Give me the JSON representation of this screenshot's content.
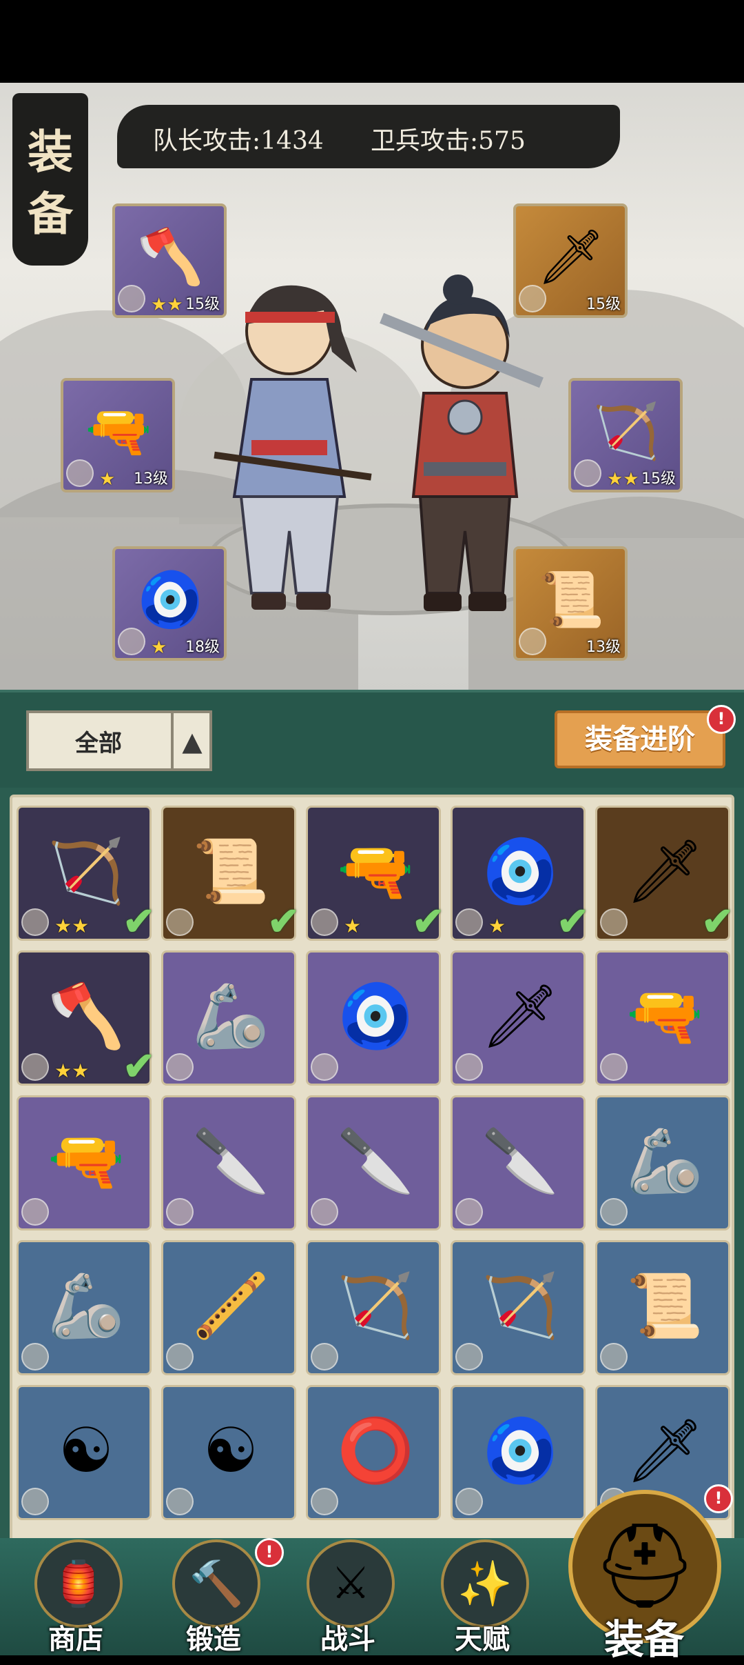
{
  "header": {
    "title": "装备",
    "captain_attack": "队长攻击:1434",
    "guard_attack": "卫兵攻击:575"
  },
  "equipped": {
    "left": [
      {
        "name": "axe",
        "icon": "🪓",
        "rarity": "purple",
        "stars": "★★",
        "level": "15级"
      },
      {
        "name": "cannon",
        "icon": "🔫",
        "rarity": "purple",
        "stars": "★",
        "level": "13级"
      },
      {
        "name": "jade-pendant",
        "icon": "🧿",
        "rarity": "purple",
        "stars": "★",
        "level": "18级"
      }
    ],
    "right": [
      {
        "name": "dagger",
        "icon": "🗡",
        "rarity": "gold",
        "stars": "",
        "level": "15级"
      },
      {
        "name": "bow",
        "icon": "🏹",
        "rarity": "purple",
        "stars": "★★",
        "level": "15级"
      },
      {
        "name": "talisman",
        "icon": "📜",
        "rarity": "gold",
        "stars": "",
        "level": "13级"
      }
    ]
  },
  "filter": {
    "selected": "全部",
    "arrow": "▲",
    "advance_button": "装备进阶",
    "advance_badge": "!"
  },
  "inventory": [
    {
      "icon": "🏹",
      "rarity": "dark",
      "stars": "★★",
      "equipped": "✔"
    },
    {
      "icon": "📜",
      "rarity": "darkgold",
      "stars": "",
      "equipped": "✔"
    },
    {
      "icon": "🔫",
      "rarity": "dark",
      "stars": "★",
      "equipped": "✔"
    },
    {
      "icon": "🧿",
      "rarity": "dark",
      "stars": "★",
      "equipped": "✔"
    },
    {
      "icon": "🗡",
      "rarity": "darkgold",
      "stars": "",
      "equipped": "✔"
    },
    {
      "icon": "🪓",
      "rarity": "dark",
      "stars": "★★",
      "equipped": "✔"
    },
    {
      "icon": "🦾",
      "rarity": "purple",
      "stars": "",
      "equipped": ""
    },
    {
      "icon": "🧿",
      "rarity": "purple",
      "stars": "",
      "equipped": ""
    },
    {
      "icon": "🗡",
      "rarity": "purple",
      "stars": "",
      "equipped": ""
    },
    {
      "icon": "🔫",
      "rarity": "purple",
      "stars": "",
      "equipped": ""
    },
    {
      "icon": "🔫",
      "rarity": "purple",
      "stars": "",
      "equipped": ""
    },
    {
      "icon": "🔪",
      "rarity": "purple",
      "stars": "",
      "equipped": ""
    },
    {
      "icon": "🔪",
      "rarity": "purple",
      "stars": "",
      "equipped": ""
    },
    {
      "icon": "🔪",
      "rarity": "purple",
      "stars": "",
      "equipped": ""
    },
    {
      "icon": "🦾",
      "rarity": "blue",
      "stars": "",
      "equipped": ""
    },
    {
      "icon": "🦾",
      "rarity": "blue",
      "stars": "",
      "equipped": ""
    },
    {
      "icon": "🪈",
      "rarity": "blue",
      "stars": "",
      "equipped": ""
    },
    {
      "icon": "🏹",
      "rarity": "blue",
      "stars": "",
      "equipped": ""
    },
    {
      "icon": "🏹",
      "rarity": "blue",
      "stars": "",
      "equipped": ""
    },
    {
      "icon": "📜",
      "rarity": "blue",
      "stars": "",
      "equipped": ""
    },
    {
      "icon": "☯",
      "rarity": "blue",
      "stars": "",
      "equipped": ""
    },
    {
      "icon": "☯",
      "rarity": "blue",
      "stars": "",
      "equipped": ""
    },
    {
      "icon": "⭕",
      "rarity": "blue",
      "stars": "",
      "equipped": ""
    },
    {
      "icon": "🧿",
      "rarity": "blue",
      "stars": "",
      "equipped": ""
    },
    {
      "icon": "🗡",
      "rarity": "blue",
      "stars": "",
      "equipped": ""
    }
  ],
  "nav": [
    {
      "name": "shop",
      "label": "商店",
      "icon": "🏮",
      "badge": ""
    },
    {
      "name": "forge",
      "label": "锻造",
      "icon": "🔨",
      "badge": "!"
    },
    {
      "name": "battle",
      "label": "战斗",
      "icon": "⚔",
      "badge": ""
    },
    {
      "name": "talent",
      "label": "天赋",
      "icon": "✨",
      "badge": ""
    }
  ],
  "nav_active": {
    "name": "equipment",
    "label": "装备",
    "icon": "⛑",
    "badge": "!"
  },
  "colors": {
    "panel_green": "#27574b",
    "badge_red": "#d9303a",
    "gold_button": "#e4a050"
  }
}
